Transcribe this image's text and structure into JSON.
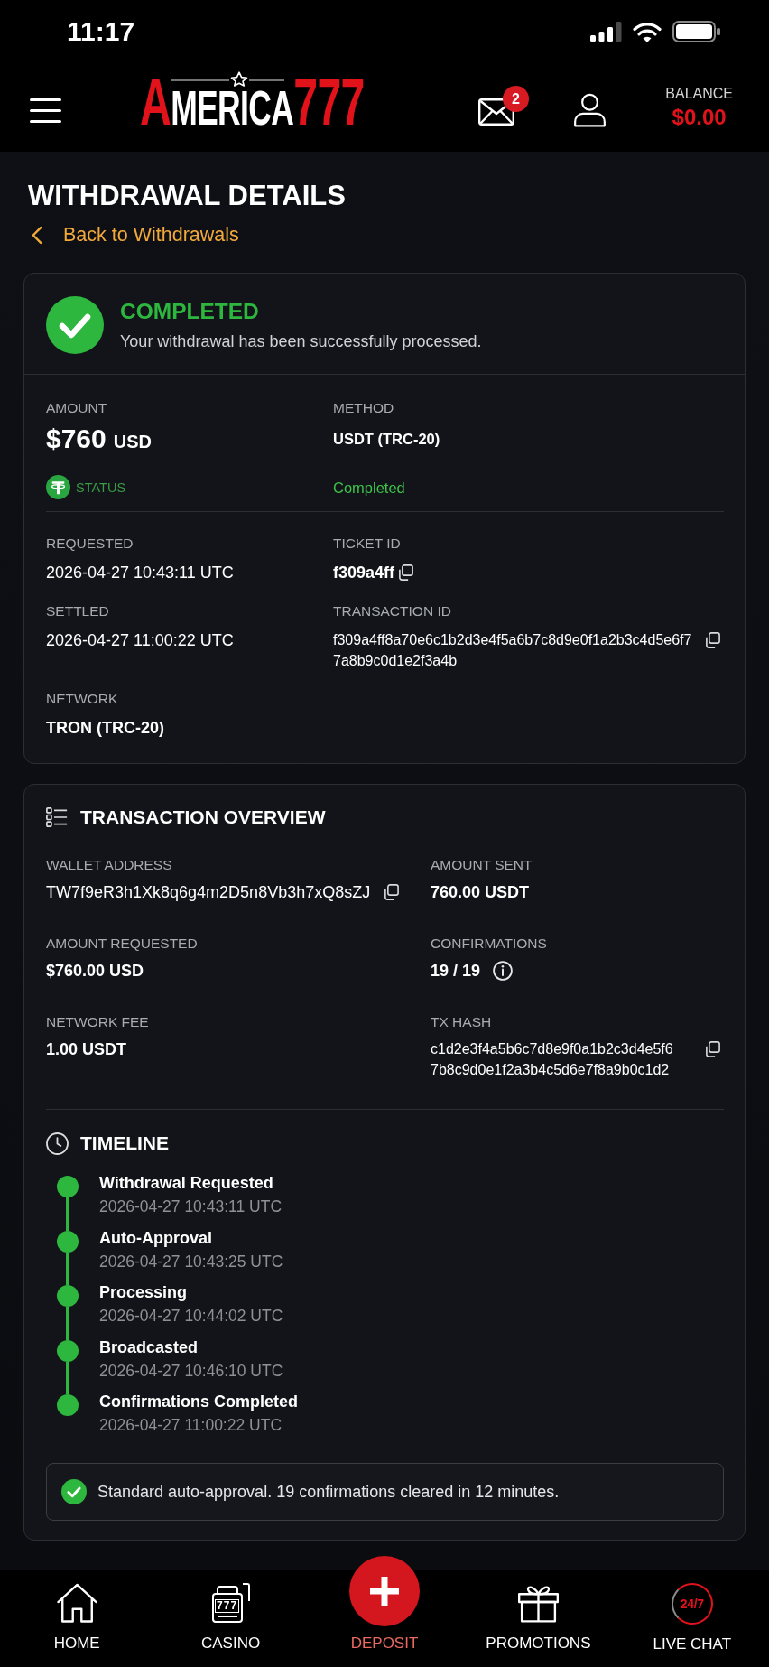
{
  "status_bar": {
    "time": "11:17"
  },
  "header": {
    "logo": [
      {
        "text": "A",
        "kind": "accent"
      },
      {
        "text": "MERICA",
        "kind": "plain"
      },
      {
        "text": "777",
        "kind": "accent"
      }
    ],
    "mail_badge": "2",
    "balance_label": "BALANCE",
    "balance": "$0.00"
  },
  "page": {
    "title": "WITHDRAWAL DETAILS",
    "back_link": "Back to Withdrawals"
  },
  "summary": {
    "status_title": "COMPLETED",
    "status_message": "Your withdrawal has been successfully processed.",
    "amount": {
      "label": "AMOUNT",
      "value": "$760",
      "currency": "USD"
    },
    "method": {
      "label": "METHOD",
      "value": "USDT (TRC-20)"
    },
    "status": {
      "label": "STATUS",
      "value": "Completed"
    },
    "fields": [
      {
        "label": "REQUESTED",
        "kind": "plain",
        "lines": [
          "2026-04-27 10:43:11 UTC"
        ],
        "copyable": false,
        "has_tooltip": false
      },
      {
        "label": "TICKET ID",
        "kind": "strong",
        "lines": [
          "f309a4ff"
        ],
        "copyable": true,
        "has_tooltip": false
      },
      {
        "label": "SETTLED",
        "kind": "plain",
        "lines": [
          "2026-04-27 11:00:22 UTC"
        ],
        "copyable": false,
        "has_tooltip": false
      },
      {
        "label": "TRANSACTION ID",
        "kind": "hash",
        "lines": [
          "f309a4ff8a70e6c1b2d3e4f5a6b7c8d9e0f1a2b3c4d5e6f7",
          "7a8b9c0d1e2f3a4b"
        ],
        "copyable": true,
        "has_tooltip": false
      },
      {
        "label": "NETWORK",
        "kind": "strong",
        "lines": [
          "TRON (TRC-20)"
        ],
        "copyable": false,
        "has_tooltip": false
      }
    ]
  },
  "overview": {
    "title": "TRANSACTION OVERVIEW",
    "fields": [
      {
        "label": "WALLET ADDRESS",
        "kind": "plain",
        "lines": [
          "TW7f9eR3h1Xk8q6g4m2D5n8Vb3h7xQ8sZJ"
        ],
        "copyable": true,
        "has_tooltip": false
      },
      {
        "label": "AMOUNT SENT",
        "kind": "strong",
        "lines": [
          "760.00 USDT"
        ],
        "copyable": false,
        "has_tooltip": false
      },
      {
        "label": "AMOUNT REQUESTED",
        "kind": "strong",
        "lines": [
          "$760.00 USD"
        ],
        "copyable": false,
        "has_tooltip": false
      },
      {
        "label": "CONFIRMATIONS",
        "kind": "strong",
        "lines": [
          "19 / 19"
        ],
        "copyable": false,
        "has_tooltip": true
      },
      {
        "label": "NETWORK FEE",
        "kind": "strong",
        "lines": [
          "1.00 USDT"
        ],
        "copyable": false,
        "has_tooltip": false
      },
      {
        "label": "TX HASH",
        "kind": "hash",
        "lines": [
          "c1d2e3f4a5b6c7d8e9f0a1b2c3d4e5f6",
          "7b8c9d0e1f2a3b4c5d6e7f8a9b0c1d2"
        ],
        "copyable": true,
        "has_tooltip": false
      }
    ]
  },
  "timeline": {
    "title": "TIMELINE",
    "events": [
      {
        "title": "Withdrawal Requested",
        "time": "2026-04-27 10:43:11 UTC",
        "done": true
      },
      {
        "title": "Auto-Approval",
        "time": "2026-04-27 10:43:25 UTC",
        "done": true
      },
      {
        "title": "Processing",
        "time": "2026-04-27 10:44:02 UTC",
        "done": true
      },
      {
        "title": "Broadcasted",
        "time": "2026-04-27 10:46:10 UTC",
        "done": true
      },
      {
        "title": "Confirmations Completed",
        "time": "2026-04-27 11:00:22 UTC",
        "done": true
      }
    ],
    "note": "Standard auto-approval. 19 confirmations cleared in 12 minutes."
  },
  "bottom_nav": [
    {
      "label": "HOME",
      "kind": "home"
    },
    {
      "label": "CASINO",
      "kind": "casino",
      "icon_text": "777"
    },
    {
      "label": "DEPOSIT",
      "kind": "deposit"
    },
    {
      "label": "PROMOTIONS",
      "kind": "promotions"
    },
    {
      "label": "LIVE CHAT",
      "kind": "chat",
      "icon_text": "24/7"
    }
  ]
}
